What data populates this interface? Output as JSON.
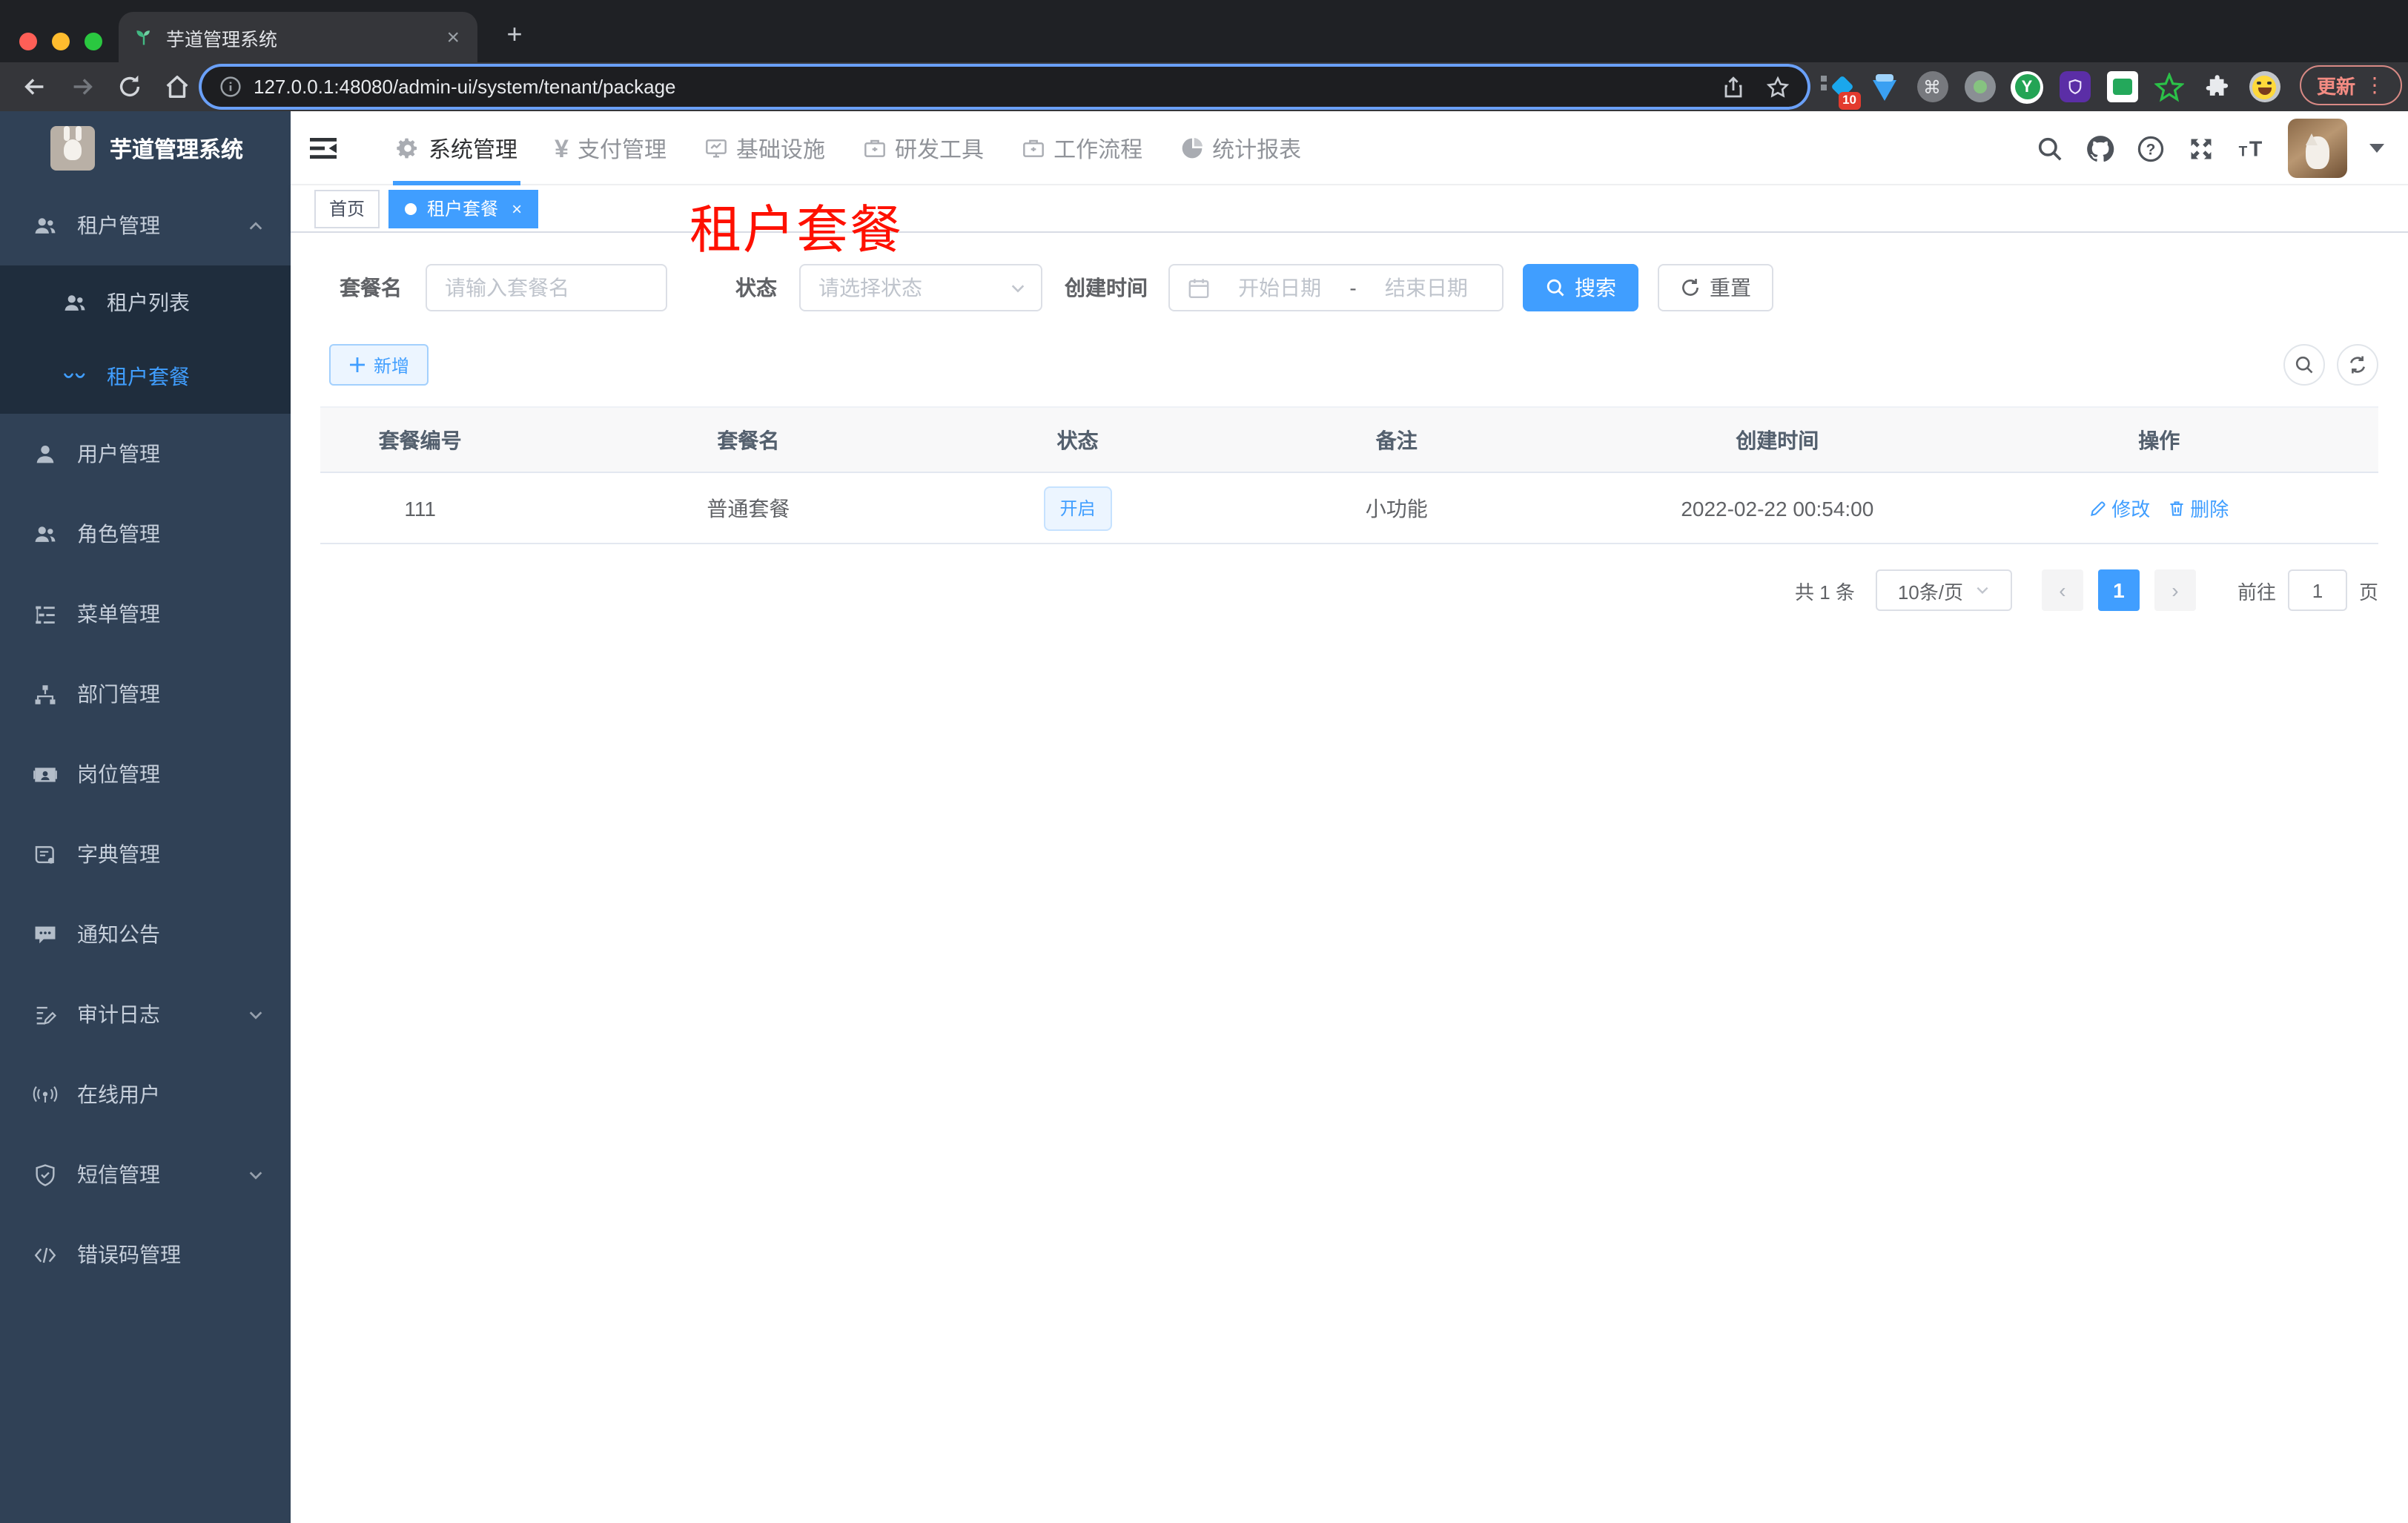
{
  "colors": {
    "accent": "#409EFF",
    "sidebar_bg": "#304156",
    "submenu_bg": "#1f2d3d",
    "overlay_red": "#fe1000",
    "tag_active_bg": "#409EFF"
  },
  "browser": {
    "tab_title": "芋道管理系统",
    "url": "127.0.0.1:48080/admin-ui/system/tenant/package",
    "update_label": "更新",
    "ext_badge": "10"
  },
  "glyphs": {
    "close": "×",
    "newtab": "+",
    "dots": "⋮",
    "cmd": "⌘",
    "ext_y": "Y",
    "yen": "¥",
    "question": "?",
    "t_small": "T",
    "t_big": "T",
    "chevron_left": "‹",
    "chevron_right": "›",
    "date_separator": "-"
  },
  "sidebar": {
    "logo_title": "芋道管理系统",
    "items": [
      {
        "label": "租户管理",
        "icon": "peoples-icon",
        "expanded": true,
        "children": [
          {
            "label": "租户列表",
            "icon": "peoples-icon"
          },
          {
            "label": "租户套餐",
            "icon": "package-icon",
            "active": true
          }
        ]
      },
      {
        "label": "用户管理",
        "icon": "user-icon"
      },
      {
        "label": "角色管理",
        "icon": "peoples-icon"
      },
      {
        "label": "菜单管理",
        "icon": "tree-table-icon"
      },
      {
        "label": "部门管理",
        "icon": "org-tree-icon"
      },
      {
        "label": "岗位管理",
        "icon": "post-icon"
      },
      {
        "label": "字典管理",
        "icon": "dict-icon"
      },
      {
        "label": "通知公告",
        "icon": "message-icon"
      },
      {
        "label": "审计日志",
        "icon": "log-icon",
        "has_children": true
      },
      {
        "label": "在线用户",
        "icon": "online-icon"
      },
      {
        "label": "短信管理",
        "icon": "sms-shield-icon",
        "has_children": true
      },
      {
        "label": "错误码管理",
        "icon": "code-icon"
      }
    ]
  },
  "topnav": {
    "items": [
      {
        "label": "系统管理",
        "icon": "gear-icon",
        "active": true
      },
      {
        "label": "支付管理",
        "icon": "yen-icon"
      },
      {
        "label": "基础设施",
        "icon": "monitor-icon"
      },
      {
        "label": "研发工具",
        "icon": "briefcase-icon"
      },
      {
        "label": "工作流程",
        "icon": "briefcase-icon"
      },
      {
        "label": "统计报表",
        "icon": "pie-chart-icon"
      }
    ]
  },
  "tags": {
    "home": "首页",
    "active": "租户套餐"
  },
  "page": {
    "overlay_title": "租户套餐"
  },
  "filters": {
    "name_label": "套餐名",
    "name_placeholder": "请输入套餐名",
    "status_label": "状态",
    "status_placeholder": "请选择状态",
    "date_label": "创建时间",
    "date_start_placeholder": "开始日期",
    "date_end_placeholder": "结束日期",
    "search_label": "搜索",
    "reset_label": "重置"
  },
  "toolbar": {
    "add_label": "新增"
  },
  "table": {
    "columns": [
      "套餐编号",
      "套餐名",
      "状态",
      "备注",
      "创建时间",
      "操作"
    ],
    "rows": [
      {
        "id": "111",
        "name": "普通套餐",
        "status": "开启",
        "remark": "小功能",
        "created": "2022-02-22 00:54:00",
        "edit_label": "修改",
        "delete_label": "删除"
      }
    ]
  },
  "pagination": {
    "total": "共 1 条",
    "page_size": "10条/页",
    "current": "1",
    "goto_label": "前往",
    "goto_value": "1",
    "unit": "页"
  }
}
